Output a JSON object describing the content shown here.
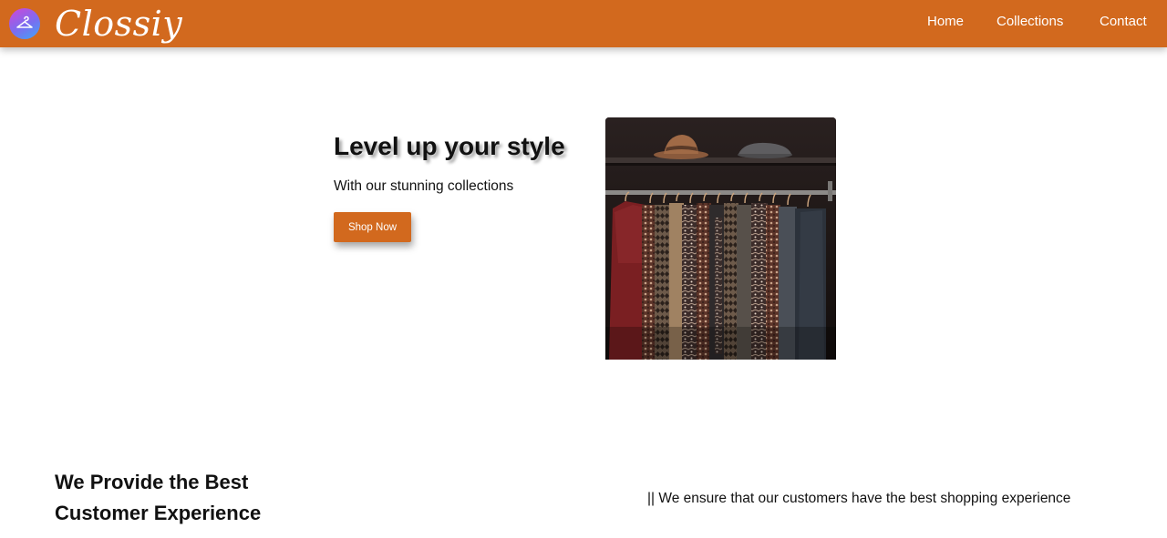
{
  "nav": {
    "brand": "Clossiy",
    "brand_icon": "clothes-hanger-icon",
    "links": [
      "Home",
      "Collections",
      "Contact"
    ],
    "colors": {
      "bar": "#d2691e",
      "text": "#ffffff"
    }
  },
  "hero": {
    "title": "Level up your style",
    "subtitle": "With our stunning collections",
    "cta_label": "Shop Now",
    "image_subject": "clothing-rack-photo"
  },
  "features": {
    "title_line1": "We Provide the Best",
    "title_line2": "Customer Experience",
    "note": "|| We ensure that our customers have the best shopping experience"
  }
}
